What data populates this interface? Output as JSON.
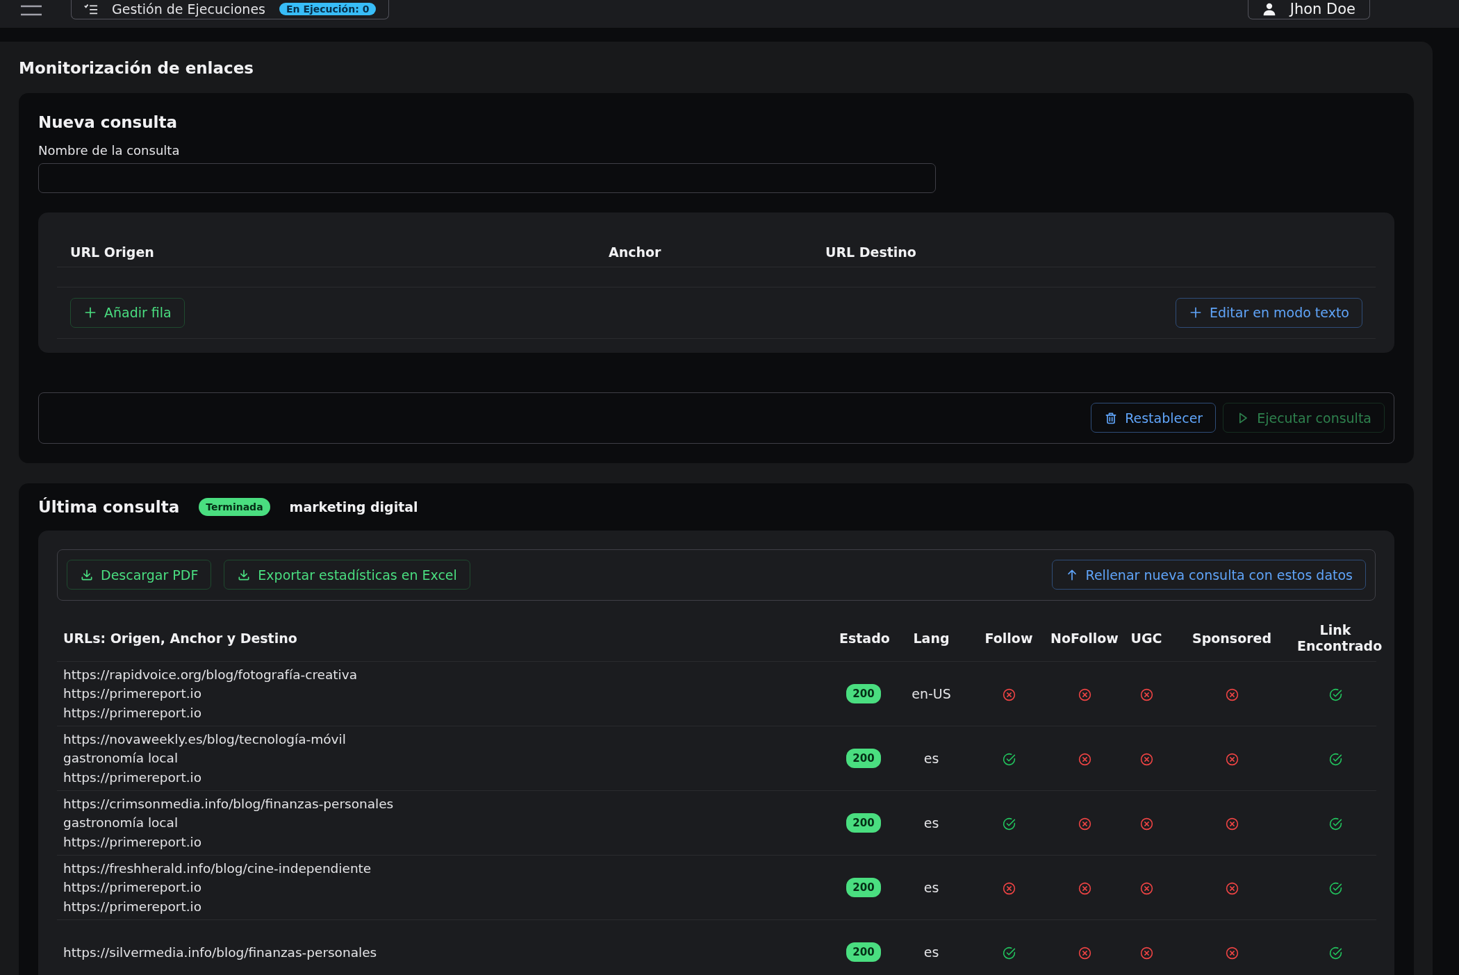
{
  "topbar": {
    "executions_button": {
      "label": "Gestión de Ejecuciones",
      "badge": "En Ejecución: 0"
    },
    "user_button": {
      "label": "Jhon Doe"
    }
  },
  "page_title": "Monitorización de enlaces",
  "new_query": {
    "title": "Nueva consulta",
    "name_field": {
      "label": "Nombre de la consulta"
    },
    "columns": [
      "URL Origen",
      "Anchor",
      "URL Destino"
    ],
    "add_row_button": {
      "label": "Añadir fila"
    },
    "text_mode_button": {
      "label": "Editar en modo texto"
    },
    "reset_button": {
      "label": "Restablecer",
      "disabled": false
    },
    "run_button": {
      "label": "Ejecutar consulta",
      "disabled": true
    }
  },
  "last_query": {
    "title": "Última consulta",
    "status_badge": "Terminada",
    "query_name": "marketing digital",
    "actions": [
      {
        "label": "Descargar PDF"
      },
      {
        "label": "Exportar estadísticas en Excel"
      }
    ],
    "fill_button": {
      "label": "Rellenar nueva consulta con estos datos"
    },
    "columns": [
      "URLs: Origen, Anchor y Destino",
      "Estado",
      "Lang",
      "Follow",
      "NoFollow",
      "UGC",
      "Sponsored",
      "Link Encontrado"
    ],
    "rows": [
      {
        "origin": "https://rapidvoice.org/blog/fotografía-creativa",
        "anchor": "https://primereport.io",
        "destination": "https://primereport.io",
        "status": "200",
        "lang": "en-US",
        "follow": false,
        "nofollow": false,
        "ugc": false,
        "sponsored": false,
        "link_found": true
      },
      {
        "origin": "https://novaweekly.es/blog/tecnología-móvil",
        "anchor": "gastronomía local",
        "destination": "https://primereport.io",
        "status": "200",
        "lang": "es",
        "follow": true,
        "nofollow": false,
        "ugc": false,
        "sponsored": false,
        "link_found": true
      },
      {
        "origin": "https://crimsonmedia.info/blog/finanzas-personales",
        "anchor": "gastronomía local",
        "destination": "https://primereport.io",
        "status": "200",
        "lang": "es",
        "follow": true,
        "nofollow": false,
        "ugc": false,
        "sponsored": false,
        "link_found": true
      },
      {
        "origin": "https://freshherald.info/blog/cine-independiente",
        "anchor": "https://primereport.io",
        "destination": "https://primereport.io",
        "status": "200",
        "lang": "es",
        "follow": false,
        "nofollow": false,
        "ugc": false,
        "sponsored": false,
        "link_found": true
      },
      {
        "origin": "https://silvermedia.info/blog/finanzas-personales",
        "status": "200",
        "lang": "es",
        "follow": true,
        "nofollow": false,
        "ugc": false,
        "sponsored": false,
        "link_found": true
      }
    ]
  }
}
